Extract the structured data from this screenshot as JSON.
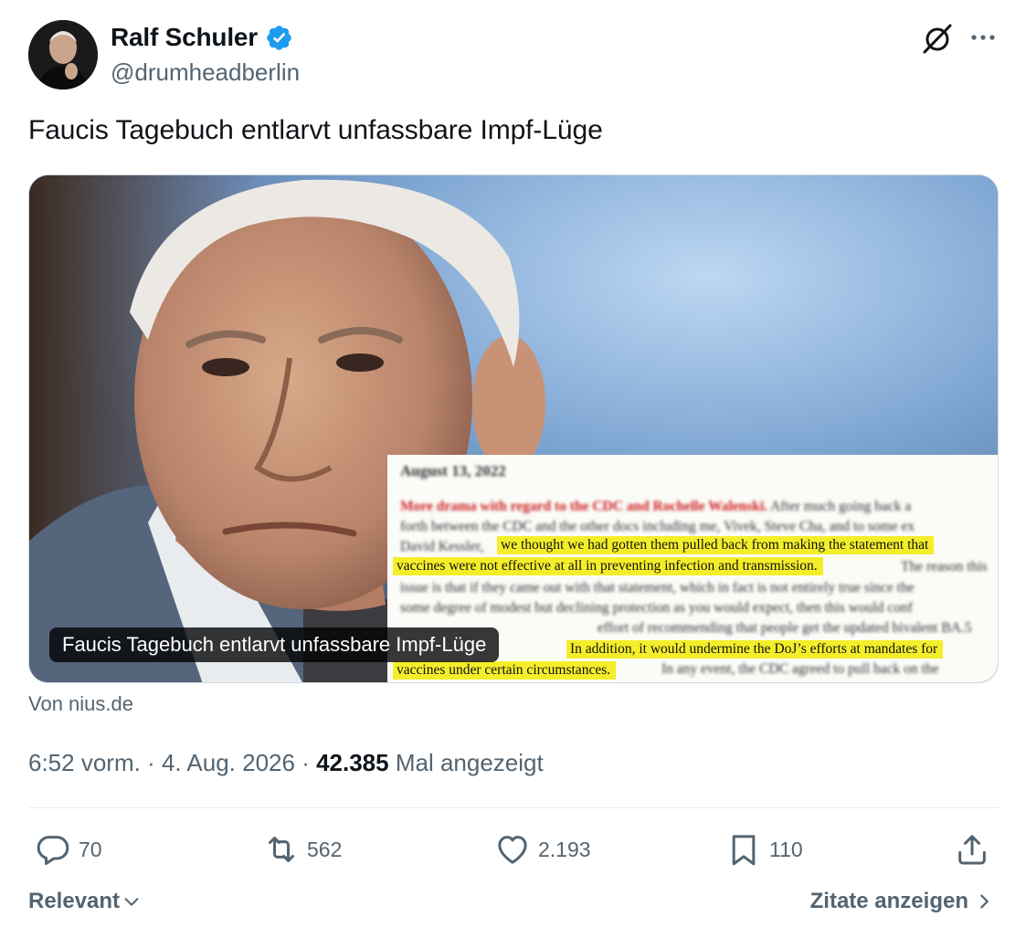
{
  "author": {
    "name": "Ralf Schuler",
    "handle": "@drumheadberlin",
    "verified": true,
    "verified_color": "#1d9bf0",
    "avatar_icon": "avatar-photo"
  },
  "header_icons": [
    "grok-icon",
    "more-icon"
  ],
  "tweet": {
    "text": "Faucis Tagebuch entlarvt unfassbare Impf-Lüge"
  },
  "card": {
    "caption": "Faucis Tagebuch entlarvt unfassbare Impf-Lüge",
    "source": "Von nius.de",
    "document": {
      "date": "August 13, 2022",
      "line1_red": "More drama with regard to the CDC and Rochelle Walenski.",
      "line1_rest": "After much going back a",
      "line2": "forth between the CDC and the other docs including me, Vivek, Steve Cha, and to some ex",
      "line3_prefix": "David Kessler,",
      "highlight1": "we thought we had gotten them pulled back from making the statement that",
      "highlight2": "vaccines were not effective at all in preventing infection and transmission.",
      "line4_rest": "The reason this",
      "line5": "issue is that if they came out with that statement, which in fact is not entirely true since the",
      "line6": "some degree of modest but declining protection as you would expect, then this would conf",
      "line7": "effort of recommending that people get the updated bivalent BA.5",
      "highlight3": "In addition, it would undermine the DoJ’s efforts at mandates for",
      "highlight4": "vaccines under certain circumstances.",
      "line8_rest": "In any event, the CDC agreed to pull back on the",
      "highlight_color": "#f4ee2a"
    }
  },
  "meta": {
    "time": "6:52 vorm.",
    "separator1": " · ",
    "date": "4. Aug. 2026",
    "separator2": " · ",
    "views": "42.385",
    "views_label": " Mal angezeigt"
  },
  "actions": {
    "replies": "70",
    "reposts": "562",
    "likes": "2.193",
    "bookmarks": "110"
  },
  "footer": {
    "sort_label": "Relevant",
    "quotes_label": "Zitate anzeigen"
  },
  "colors": {
    "text": "#0f1419",
    "secondary": "#536471",
    "border": "#cfd9de",
    "divider": "#e6ecf0"
  }
}
